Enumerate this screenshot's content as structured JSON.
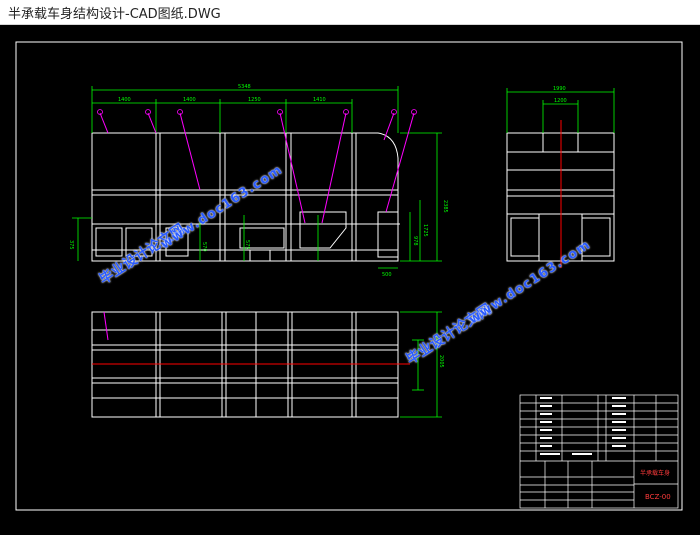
{
  "window": {
    "title": "半承载车身结构设计-CAD图纸.DWG"
  },
  "drawing": {
    "background": "#000000",
    "frame_color": "#ffffff",
    "dimension_color": "#00ff00",
    "leader_color": "#ff00ff",
    "centerline_color": "#ff0000",
    "dimensions": {
      "overall_length": "5348",
      "seg1": "1400",
      "seg2": "1400",
      "seg3": "1250",
      "seg4": "1410",
      "height_right": "2385",
      "height_mid": "1725",
      "small1": "978",
      "small2": "375",
      "small3": "570",
      "small4": "575",
      "bottom_width": "500",
      "end_width_outer": "1990",
      "end_width_inner": "1200",
      "plan_height": "2005"
    },
    "watermarks": {
      "text1": "毕业设计论文网",
      "text2": "www.doc163.com",
      "text3": "毕业设计论文网",
      "text4": "www.doc163.com"
    },
    "title_block": {
      "part_name": "半承载车身",
      "drawing_no": "BCZ-00"
    }
  }
}
